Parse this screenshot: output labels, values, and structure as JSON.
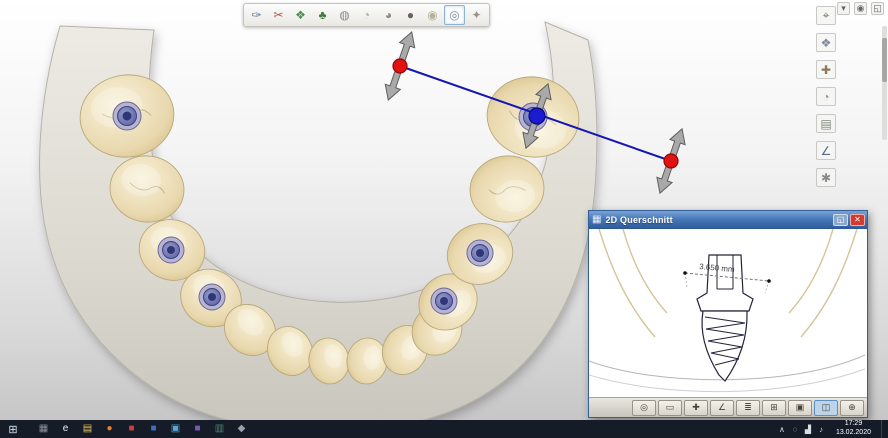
{
  "colors": {
    "measure_line": "#1616b4",
    "handle_red": "#e01212",
    "handle_blue": "#1b1bd0",
    "titlebar_from": "#79a3d8",
    "titlebar_to": "#2f5d9e",
    "taskbar_bg": "#161b28",
    "tooth": "#ead9b0",
    "gum": "#d9d6cd",
    "implant_ring": "#626bb0"
  },
  "top_toolbar": {
    "items": [
      {
        "name": "probe-tool-icon",
        "glyph": "✑",
        "color": "#5b7a9c"
      },
      {
        "name": "cut-tool-icon",
        "glyph": "✂",
        "color": "#b05540"
      },
      {
        "name": "implant-planning-icon",
        "glyph": "❖",
        "color": "#4f8f4f"
      },
      {
        "name": "model-tree-icon",
        "glyph": "♣",
        "color": "#3f7a3f"
      },
      {
        "name": "scan-data-icon",
        "glyph": "◍",
        "color": "#8a8a8a"
      },
      {
        "name": "tooth-occlusal-icon",
        "glyph": "◔",
        "color": "#b0a88e"
      },
      {
        "name": "tooth-mesial-icon",
        "glyph": "◕",
        "color": "#8f867a"
      },
      {
        "name": "tooth-buccal-icon",
        "glyph": "●",
        "color": "#6b6354"
      },
      {
        "name": "tooth-lingual-icon",
        "glyph": "◉",
        "color": "#b8b09a"
      },
      {
        "name": "tooth-selected-icon",
        "glyph": "◎",
        "color": "#7a8a9a",
        "active": true
      },
      {
        "name": "smile-design-icon",
        "glyph": "✦",
        "color": "#9a9488"
      }
    ]
  },
  "right_panel": {
    "items": [
      {
        "name": "grip-tool-icon",
        "glyph": "⌖",
        "color": "#6a7a6a"
      },
      {
        "name": "mesh-tool-icon",
        "glyph": "❖",
        "color": "#7a8a9a"
      },
      {
        "name": "screw-tool-icon",
        "glyph": "✚",
        "color": "#8a7a5a"
      },
      {
        "name": "tooth-library-icon",
        "glyph": "◔",
        "color": "#9a927e"
      },
      {
        "name": "material-icon",
        "glyph": "▤",
        "color": "#7a8a7a"
      },
      {
        "name": "measure-icon",
        "glyph": "∠",
        "color": "#5a6a8a"
      },
      {
        "name": "settings-icon",
        "glyph": "✱",
        "color": "#8a8a8a"
      }
    ],
    "corner_items": [
      {
        "name": "collapse-panel-icon",
        "glyph": "▾"
      },
      {
        "name": "camera-view-icon",
        "glyph": "◉"
      },
      {
        "name": "pin-panel-icon",
        "glyph": "◱"
      }
    ]
  },
  "window_2d": {
    "title": "2D Querschnitt",
    "window_icon_glyph": "▦",
    "measurement": "3.650 mm",
    "titlebar_buttons": [
      {
        "name": "pin-window-button",
        "glyph": "◱",
        "color": "#8aa8cc"
      },
      {
        "name": "close-window-button",
        "glyph": "✕",
        "color": "#d23b2f"
      }
    ],
    "toolbar_items": [
      {
        "name": "zoom-button",
        "glyph": "◎"
      },
      {
        "name": "ruler-button",
        "glyph": "▭"
      },
      {
        "name": "implant-view-button",
        "glyph": "✚"
      },
      {
        "name": "angle-button",
        "glyph": "∠"
      },
      {
        "name": "layers-button",
        "glyph": "≣"
      },
      {
        "name": "grid-button",
        "glyph": "⊞"
      },
      {
        "name": "save-view-button",
        "glyph": "▣"
      },
      {
        "name": "section-tool-button",
        "glyph": "◫",
        "active": true
      },
      {
        "name": "camera-button",
        "glyph": "⊕"
      }
    ]
  },
  "taskbar": {
    "start_glyph": "⊞",
    "apps": [
      {
        "name": "taskbar-app-cad",
        "glyph": "▦",
        "color": "#8a8f9a"
      },
      {
        "name": "taskbar-app-browser",
        "glyph": "e",
        "color": "#e8eef6"
      },
      {
        "name": "taskbar-folder-icon",
        "glyph": "▤",
        "color": "#e8c25a"
      },
      {
        "name": "taskbar-firefox-icon",
        "glyph": "●",
        "color": "#e8822a"
      },
      {
        "name": "taskbar-app-red",
        "glyph": "■",
        "color": "#c84038"
      },
      {
        "name": "taskbar-app-blue",
        "glyph": "■",
        "color": "#3a6cc8"
      },
      {
        "name": "taskbar-app-lightblue",
        "glyph": "▣",
        "color": "#58a8d8"
      },
      {
        "name": "taskbar-app-purple",
        "glyph": "■",
        "color": "#7a58b8"
      },
      {
        "name": "taskbar-app-green",
        "glyph": "▥",
        "color": "#4a8a6a"
      },
      {
        "name": "taskbar-app-gray",
        "glyph": "◆",
        "color": "#9aa2b0"
      }
    ],
    "tray_icons": [
      {
        "name": "tray-chevron-icon",
        "glyph": "∧"
      },
      {
        "name": "tray-cloud-icon",
        "glyph": "◌"
      },
      {
        "name": "tray-network-icon",
        "glyph": "▟"
      },
      {
        "name": "tray-volume-icon",
        "glyph": "♪"
      }
    ],
    "clock_time": "17:29",
    "clock_date": "13.02.2020"
  }
}
